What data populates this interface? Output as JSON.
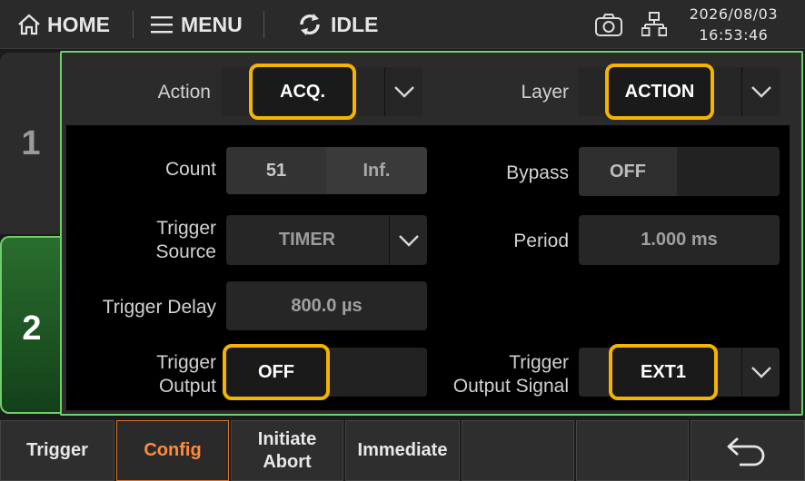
{
  "topbar": {
    "home_label": "HOME",
    "menu_label": "MENU",
    "status_label": "IDLE",
    "date": "2026/08/03",
    "time": "16:53:46"
  },
  "tabs": [
    {
      "label": "1",
      "active": false
    },
    {
      "label": "2",
      "active": true
    }
  ],
  "header": {
    "action_label": "Action",
    "action_value": "ACQ.",
    "layer_label": "Layer",
    "layer_value": "ACTION"
  },
  "config": {
    "count_label": "Count",
    "count_value": "51",
    "count_inf": "Inf.",
    "bypass_label": "Bypass",
    "bypass_value": "OFF",
    "trigger_source_label_1": "Trigger",
    "trigger_source_label_2": "Source",
    "trigger_source_value": "TIMER",
    "period_label": "Period",
    "period_value": "1.000 ms",
    "trigger_delay_label": "Trigger Delay",
    "trigger_delay_value": "800.0 µs",
    "trigger_output_label_1": "Trigger",
    "trigger_output_label_2": "Output",
    "trigger_output_value": "OFF",
    "trigger_output_signal_label_1": "Trigger",
    "trigger_output_signal_label_2": "Output Signal",
    "trigger_output_signal_value": "EXT1"
  },
  "softkeys": {
    "trigger": "Trigger",
    "config": "Config",
    "initiate_1": "Initiate",
    "initiate_2": "Abort",
    "immediate": "Immediate"
  },
  "colors": {
    "accent_green": "#6fcf6a",
    "highlight_yellow": "#f5b400",
    "active_softkey": "#ff8a3d"
  }
}
